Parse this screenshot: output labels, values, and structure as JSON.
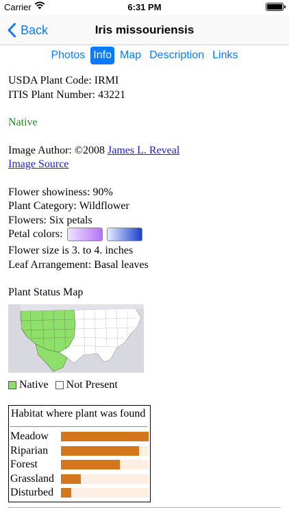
{
  "status_bar": {
    "carrier": "Carrier",
    "time": "6:31 PM"
  },
  "nav": {
    "back_label": "Back",
    "title": "Iris missouriensis"
  },
  "tabs": [
    "Photos",
    "Info",
    "Map",
    "Description",
    "Links"
  ],
  "active_tab": "Info",
  "info": {
    "usda_code": "USDA Plant Code: IRMI",
    "itis_number": "ITIS Plant Number: 43221",
    "status": "Native",
    "image_author_prefix": "Image Author: ©2008 ",
    "image_author_link": "James L. Reveal",
    "image_source": "Image Source",
    "flower_showiness": "Flower showiness: 90%",
    "plant_category": "Plant Category: Wildflower",
    "flowers": "Flowers: Six petals",
    "petal_colors_label": "Petal colors:",
    "petal_colors": [
      "#b673f5",
      "#1b3fcf"
    ],
    "flower_size": "Flower size is 3. to 4. inches",
    "leaf_arrangement": "Leaf Arrangement: Basal leaves"
  },
  "map_section": {
    "title": "Plant Status Map",
    "legend_native": "Native",
    "legend_not_present": "Not Present",
    "native_color": "#8fe06a"
  },
  "habitat": {
    "title": "Habitat where plant was found",
    "rows": [
      {
        "label": "Meadow",
        "fraction": 1.0
      },
      {
        "label": "Riparian",
        "fraction": 0.89
      },
      {
        "label": "Forest",
        "fraction": 0.67
      },
      {
        "label": "Grassland",
        "fraction": 0.23
      },
      {
        "label": "Disturbed",
        "fraction": 0.12
      }
    ],
    "bar_color": "#d4761d"
  }
}
